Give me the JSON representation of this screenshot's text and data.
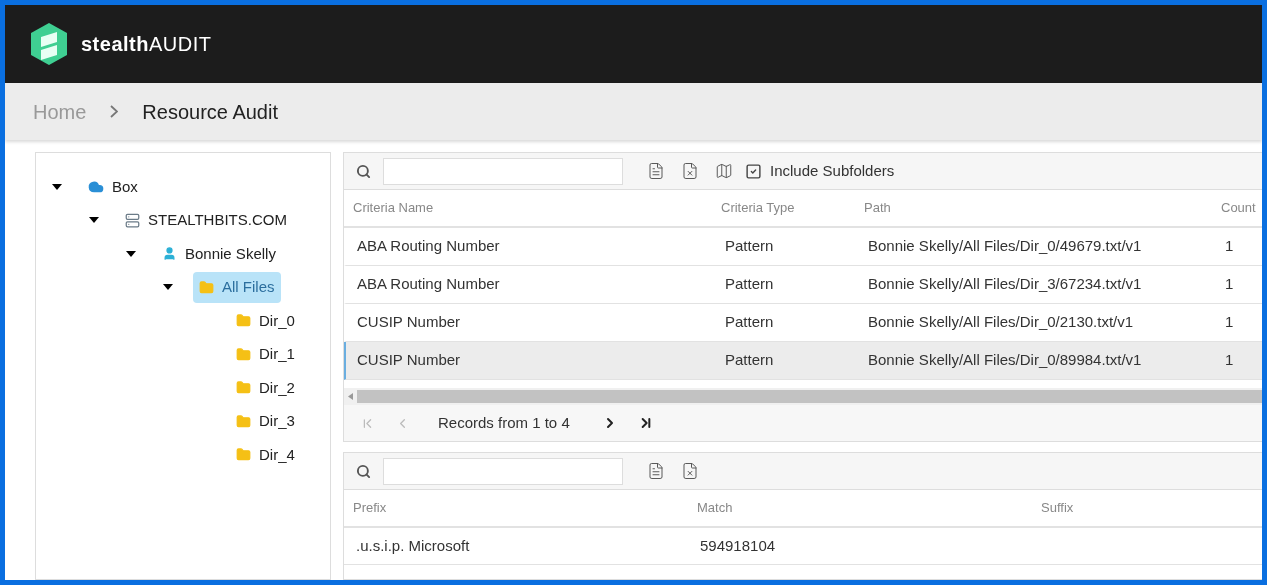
{
  "app": {
    "logo_bold": "stealth",
    "logo_light": "AUDIT"
  },
  "breadcrumb": [
    {
      "label": "Home",
      "current": false
    },
    {
      "label": "Resource Audit",
      "current": true
    }
  ],
  "tree": [
    {
      "label": "Box",
      "kind": "cloud",
      "expanded": true,
      "selected": false,
      "children": [
        {
          "label": "STEALTHBITS.COM",
          "kind": "server",
          "expanded": true,
          "selected": false,
          "children": [
            {
              "label": "Bonnie Skelly",
              "kind": "user",
              "expanded": true,
              "selected": false,
              "children": [
                {
                  "label": "All Files",
                  "kind": "folder",
                  "expanded": true,
                  "selected": true,
                  "children": [
                    {
                      "label": "Dir_0",
                      "kind": "folder",
                      "selected": false
                    },
                    {
                      "label": "Dir_1",
                      "kind": "folder",
                      "selected": false
                    },
                    {
                      "label": "Dir_2",
                      "kind": "folder",
                      "selected": false
                    },
                    {
                      "label": "Dir_3",
                      "kind": "folder",
                      "selected": false
                    },
                    {
                      "label": "Dir_4",
                      "kind": "folder",
                      "selected": false
                    }
                  ]
                }
              ]
            }
          ]
        }
      ]
    }
  ],
  "results": {
    "include_subfolders": {
      "label": "Include Subfolders",
      "checked": true
    },
    "columns": [
      "Criteria Name",
      "Criteria Type",
      "Path",
      "Count"
    ],
    "rows": [
      {
        "cells": [
          "ABA Routing Number",
          "Pattern",
          "Bonnie Skelly/All Files/Dir_0/49679.txt/v1",
          "1"
        ],
        "selected": false
      },
      {
        "cells": [
          "ABA Routing Number",
          "Pattern",
          "Bonnie Skelly/All Files/Dir_3/67234.txt/v1",
          "1"
        ],
        "selected": false
      },
      {
        "cells": [
          "CUSIP Number",
          "Pattern",
          "Bonnie Skelly/All Files/Dir_0/2130.txt/v1",
          "1"
        ],
        "selected": false
      },
      {
        "cells": [
          "CUSIP Number",
          "Pattern",
          "Bonnie Skelly/All Files/Dir_0/89984.txt/v1",
          "1"
        ],
        "selected": true
      }
    ],
    "pager": {
      "text": "Records from 1 to 4",
      "first_disabled": true,
      "prev_disabled": true,
      "next_disabled": false,
      "last_disabled": false
    }
  },
  "matches": {
    "columns": [
      "Prefix",
      "Match",
      "Suffix"
    ],
    "rows": [
      {
        "cells": [
          ".u.s.i.p. Microsoft",
          "594918104",
          ""
        ]
      }
    ]
  }
}
